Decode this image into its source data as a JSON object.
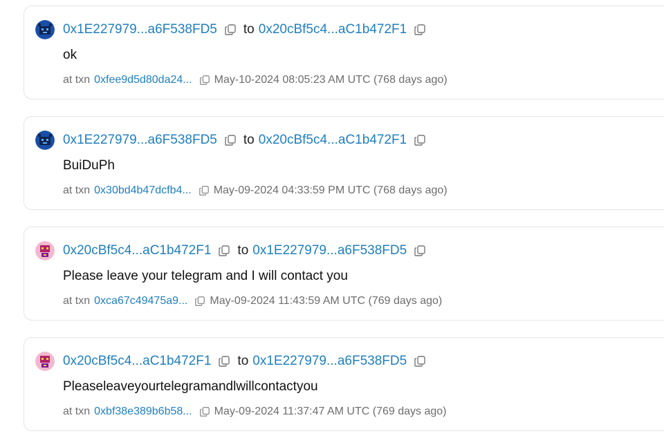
{
  "messages": [
    {
      "from": "0x1E227979...a6F538FD5",
      "to_word": "to",
      "to": "0x20cBf5c4...aC1b472F1",
      "text": "ok",
      "tx_label": "at txn",
      "tx": "0xfee9d5d80da24...",
      "time": "May-10-2024 08:05:23 AM UTC (768 days ago)",
      "avatar": "blue-robot"
    },
    {
      "from": "0x1E227979...a6F538FD5",
      "to_word": "to",
      "to": "0x20cBf5c4...aC1b472F1",
      "text": "BuiDuPh",
      "tx_label": "at txn",
      "tx": "0x30bd4b47dcfb4...",
      "time": "May-09-2024 04:33:59 PM UTC (768 days ago)",
      "avatar": "blue-robot"
    },
    {
      "from": "0x20cBf5c4...aC1b472F1",
      "to_word": "to",
      "to": "0x1E227979...a6F538FD5",
      "text": "Please leave your telegram and I will contact you",
      "tx_label": "at txn",
      "tx": "0xca67c49475a9...",
      "time": "May-09-2024 11:43:59 AM UTC (769 days ago)",
      "avatar": "pink-robot"
    },
    {
      "from": "0x20cBf5c4...aC1b472F1",
      "to_word": "to",
      "to": "0x1E227979...a6F538FD5",
      "text": "Pleaseleaveyourtelegramandlwillcontactyou",
      "tx_label": "at txn",
      "tx": "0xbf38e389b6b58...",
      "time": "May-09-2024 11:37:47 AM UTC (769 days ago)",
      "avatar": "pink-robot"
    }
  ],
  "colors": {
    "link": "#1f7fbf",
    "meta_text": "#6d6d6d",
    "border": "#e4e4e4"
  },
  "icons": {
    "copy": "copy-icon",
    "avatar_blue": "blue-robot-avatar",
    "avatar_pink": "pink-robot-avatar"
  }
}
